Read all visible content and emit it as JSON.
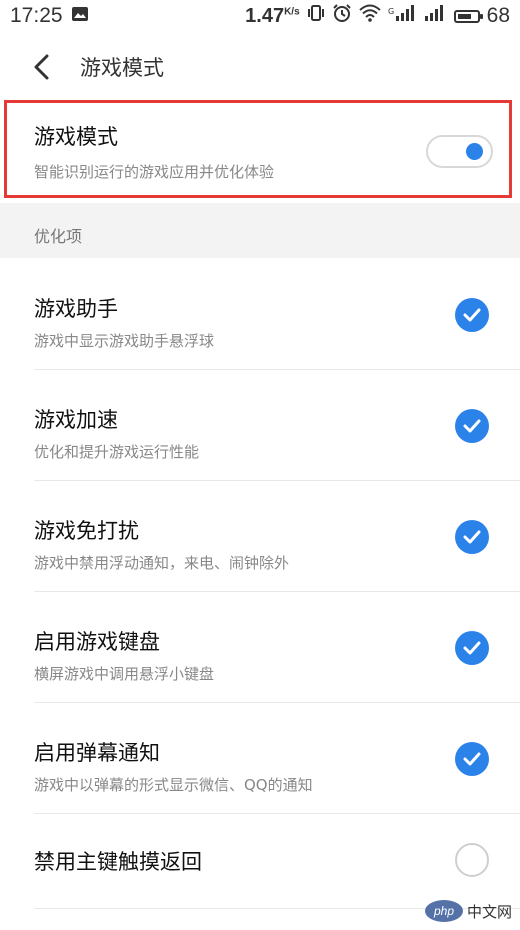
{
  "status_bar": {
    "time": "17:25",
    "network_speed": "1.47",
    "network_unit": "K/s",
    "battery": "68",
    "icons": [
      "image-icon",
      "vibrate-icon",
      "alarm-icon",
      "wifi-icon",
      "signal-icon",
      "signal-icon",
      "battery-icon"
    ]
  },
  "header": {
    "back_icon": "back-chevron-icon",
    "title": "游戏模式"
  },
  "game_mode": {
    "title": "游戏模式",
    "subtitle": "智能识别运行的游戏应用并优化体验",
    "enabled": true,
    "highlight_color": "#e53935"
  },
  "section": {
    "label": "优化项"
  },
  "items": [
    {
      "title": "游戏助手",
      "subtitle": "游戏中显示游戏助手悬浮球",
      "checked": true
    },
    {
      "title": "游戏加速",
      "subtitle": "优化和提升游戏运行性能",
      "checked": true
    },
    {
      "title": "游戏免打扰",
      "subtitle": "游戏中禁用浮动通知，来电、闹钟除外",
      "checked": true
    },
    {
      "title": "启用游戏键盘",
      "subtitle": "横屏游戏中调用悬浮小键盘",
      "checked": true
    },
    {
      "title": "启用弹幕通知",
      "subtitle": "游戏中以弹幕的形式显示微信、QQ的通知",
      "checked": true
    },
    {
      "title": "禁用主键触摸返回",
      "subtitle": "",
      "checked": false
    }
  ],
  "colors": {
    "accent": "#2b83e9",
    "section_bg": "#f3f3f3"
  },
  "watermark": {
    "logo": "php",
    "text": "中文网"
  }
}
